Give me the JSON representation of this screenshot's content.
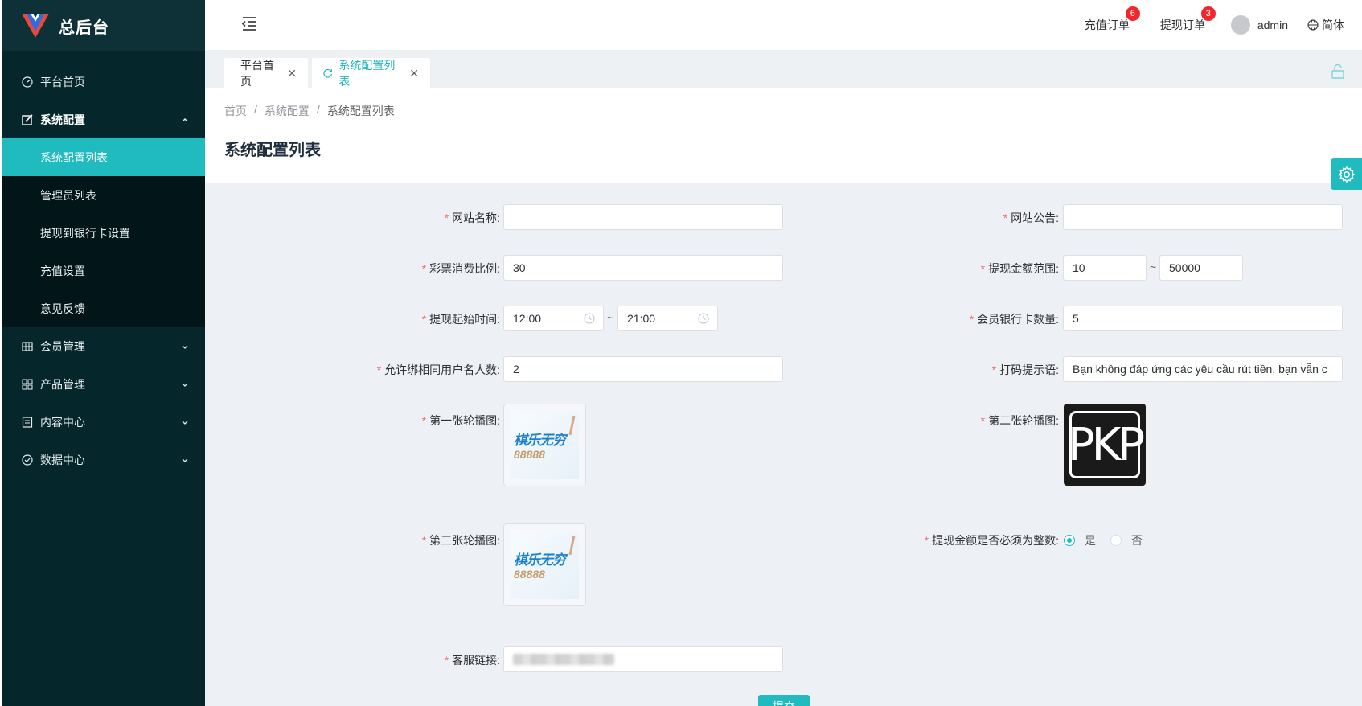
{
  "app": {
    "title": "总后台"
  },
  "sidebar": {
    "items": [
      {
        "label": "平台首页",
        "icon": "dashboard-icon"
      },
      {
        "label": "系统配置",
        "icon": "edit-icon",
        "expanded": true,
        "children": [
          "系统配置列表",
          "管理员列表",
          "提现到银行卡设置",
          "充值设置",
          "意见反馈"
        ]
      },
      {
        "label": "会员管理",
        "icon": "grid-icon"
      },
      {
        "label": "产品管理",
        "icon": "apps-icon"
      },
      {
        "label": "内容中心",
        "icon": "document-icon"
      },
      {
        "label": "数据中心",
        "icon": "check-circle-icon"
      }
    ]
  },
  "header": {
    "recharge_orders": {
      "label": "充值订单",
      "count": "6"
    },
    "withdraw_orders": {
      "label": "提现订单",
      "count": "3"
    },
    "user": "admin",
    "language": "简体"
  },
  "tabs": [
    {
      "label": "平台首页",
      "active": false
    },
    {
      "label": "系统配置列表",
      "active": true
    }
  ],
  "breadcrumb": [
    "首页",
    "系统配置",
    "系统配置列表"
  ],
  "page_title": "系统配置列表",
  "form": {
    "site_name": {
      "label": "网站名称:",
      "value": ""
    },
    "site_notice": {
      "label": "网站公告:",
      "value": ""
    },
    "lottery_ratio": {
      "label": "彩票消费比例:",
      "value": "30"
    },
    "withdraw_range": {
      "label": "提现金额范围:",
      "min": "10",
      "max": "50000",
      "separator": "~"
    },
    "withdraw_time": {
      "label": "提现起始时间:",
      "start": "12:00",
      "end": "21:00",
      "separator": "~"
    },
    "bank_card_count": {
      "label": "会员银行卡数量:",
      "value": "5"
    },
    "same_name_users": {
      "label": "允许绑相同用户名人数:",
      "value": "2"
    },
    "coding_tip": {
      "label": "打码提示语:",
      "value": "Bạn không đáp ứng các yêu cầu rút tiền, bạn vẫn c"
    },
    "banner1": {
      "label": "第一张轮播图:",
      "text1": "棋乐无穷",
      "text2": "88888"
    },
    "banner2": {
      "label": "第二张轮播图:",
      "text": "PKP"
    },
    "banner3": {
      "label": "第三张轮播图:",
      "text1": "棋乐无穷",
      "text2": "88888"
    },
    "integer_withdraw": {
      "label": "提现金额是否必须为整数:",
      "yes": "是",
      "no": "否",
      "selected": "是"
    },
    "service_link": {
      "label": "客服链接:"
    },
    "submit": "提交"
  },
  "colors": {
    "accent": "#1fbbbf",
    "sidebar_bg": "#05262b",
    "badge": "#f0282d",
    "required": "#f56c6c"
  }
}
